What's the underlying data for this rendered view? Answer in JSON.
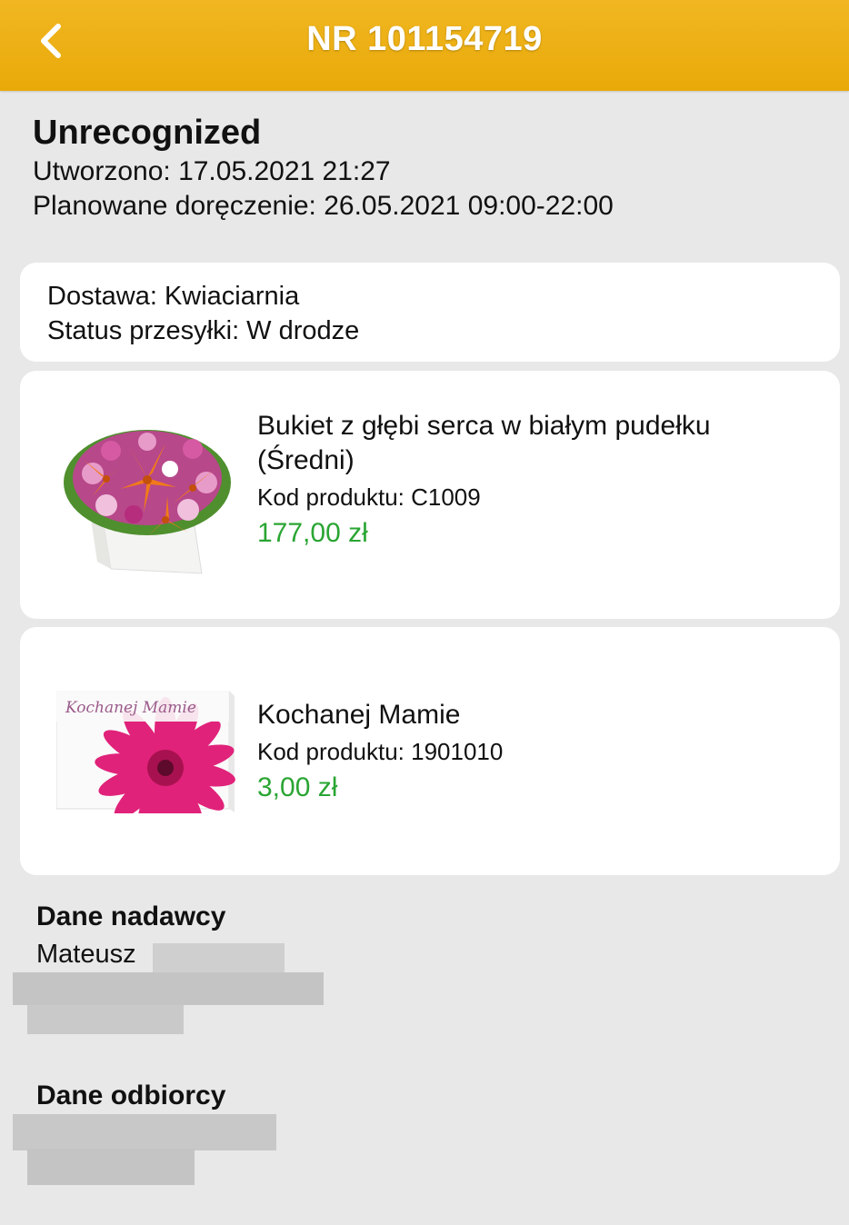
{
  "header": {
    "title": "NR 101154719",
    "back_icon": "chevron-left-icon"
  },
  "order": {
    "status": "Unrecognized",
    "created": "Utworzono: 17.05.2021 21:27",
    "planned_delivery": "Planowane doręczenie: 26.05.2021 09:00-22:00"
  },
  "delivery": {
    "method": "Dostawa: Kwiaciarnia",
    "shipment_status": "Status przesyłki: W drodze"
  },
  "products": [
    {
      "name_line1": "Bukiet z głębi serca w białym pudełku",
      "name_line2": "(Średni)",
      "code": "Kod produktu: C1009",
      "price": "177,00 zł"
    },
    {
      "name": "Kochanej Mamie",
      "code": "Kod produktu: 1901010",
      "price": "3,00 zł",
      "card_text": "Kochanej Mamie"
    }
  ],
  "sender": {
    "title": "Dane nadawcy",
    "name": "Mateusz"
  },
  "recipient": {
    "title": "Dane odbiorcy"
  },
  "colors": {
    "header": "#eeb114",
    "price": "#2aa533",
    "background": "#e8e8e8"
  }
}
